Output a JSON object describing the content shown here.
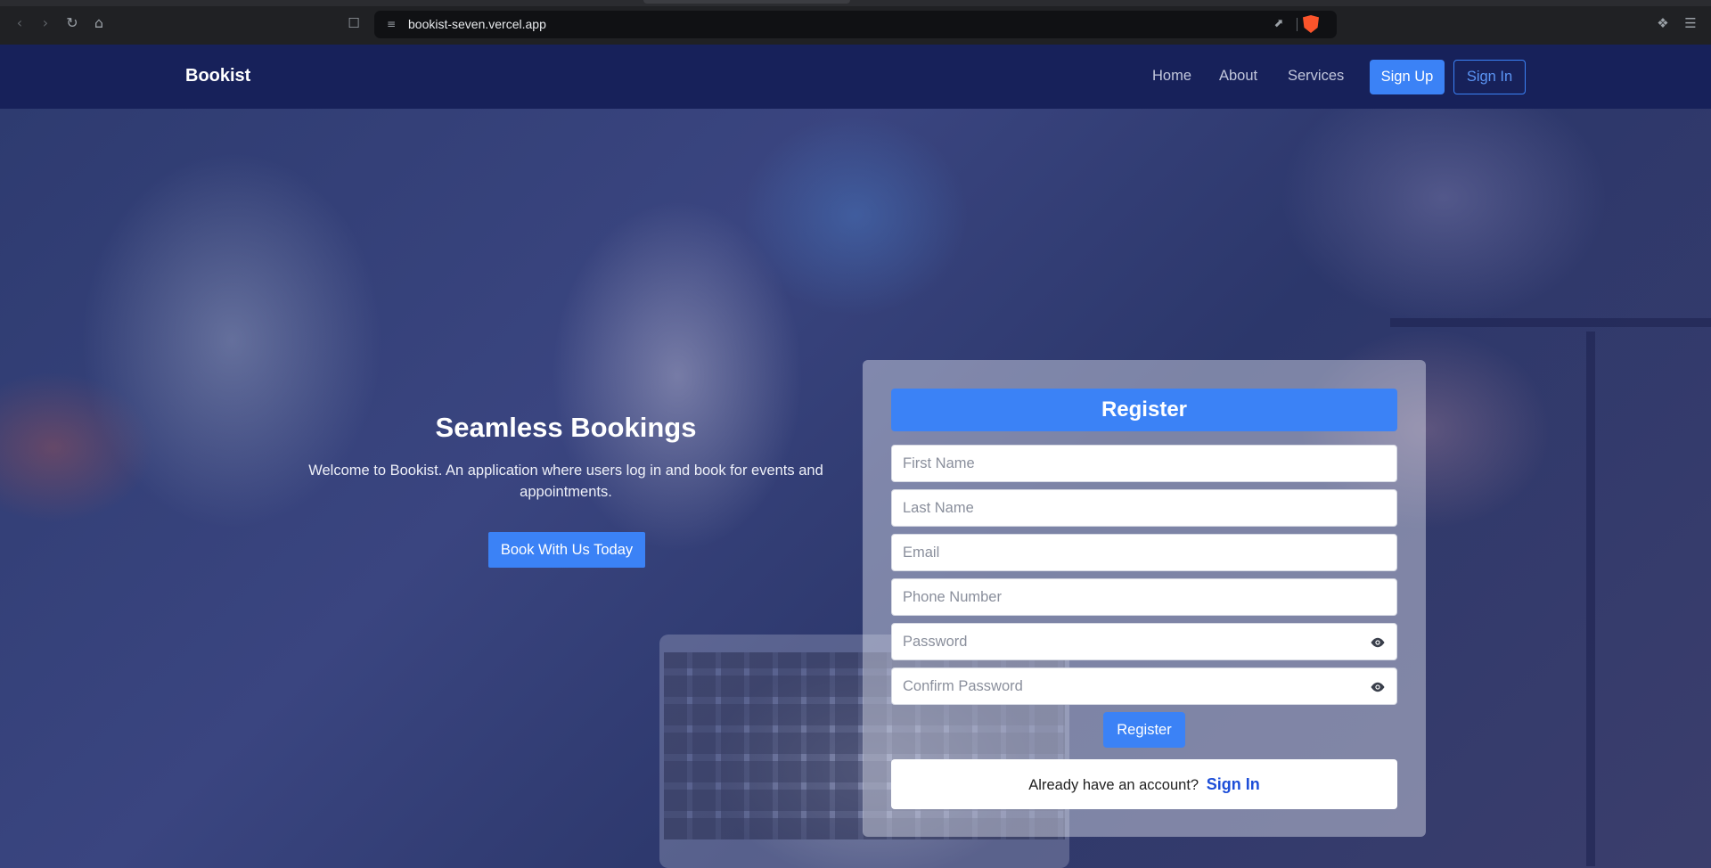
{
  "browser": {
    "url": "bookist-seven.vercel.app",
    "icons": {
      "back": "back-arrow-icon",
      "forward": "forward-arrow-icon",
      "reload": "reload-icon",
      "home": "home-icon",
      "bookmark": "bookmark-icon",
      "site_info": "site-info-icon",
      "share": "share-icon",
      "brave": "brave-shield-icon",
      "extensions": "extensions-icon",
      "menu": "menu-icon"
    }
  },
  "navbar": {
    "brand": "Bookist",
    "links": [
      "Home",
      "About",
      "Services"
    ],
    "signup_label": "Sign Up",
    "signin_label": "Sign In"
  },
  "hero": {
    "title": "Seamless Bookings",
    "subtitle": "Welcome to Bookist. An application where users log in and book for events and appointments.",
    "cta_label": "Book With Us Today"
  },
  "register": {
    "title": "Register",
    "fields": {
      "first_name": "First Name",
      "last_name": "Last Name",
      "email": "Email",
      "phone": "Phone Number",
      "password": "Password",
      "confirm_password": "Confirm Password"
    },
    "submit_label": "Register",
    "already_text": "Already have an account?",
    "signin_link": "Sign In"
  },
  "colors": {
    "navbar_bg": "#17215a",
    "primary": "#3b82f6",
    "link": "#1d4ed8"
  }
}
